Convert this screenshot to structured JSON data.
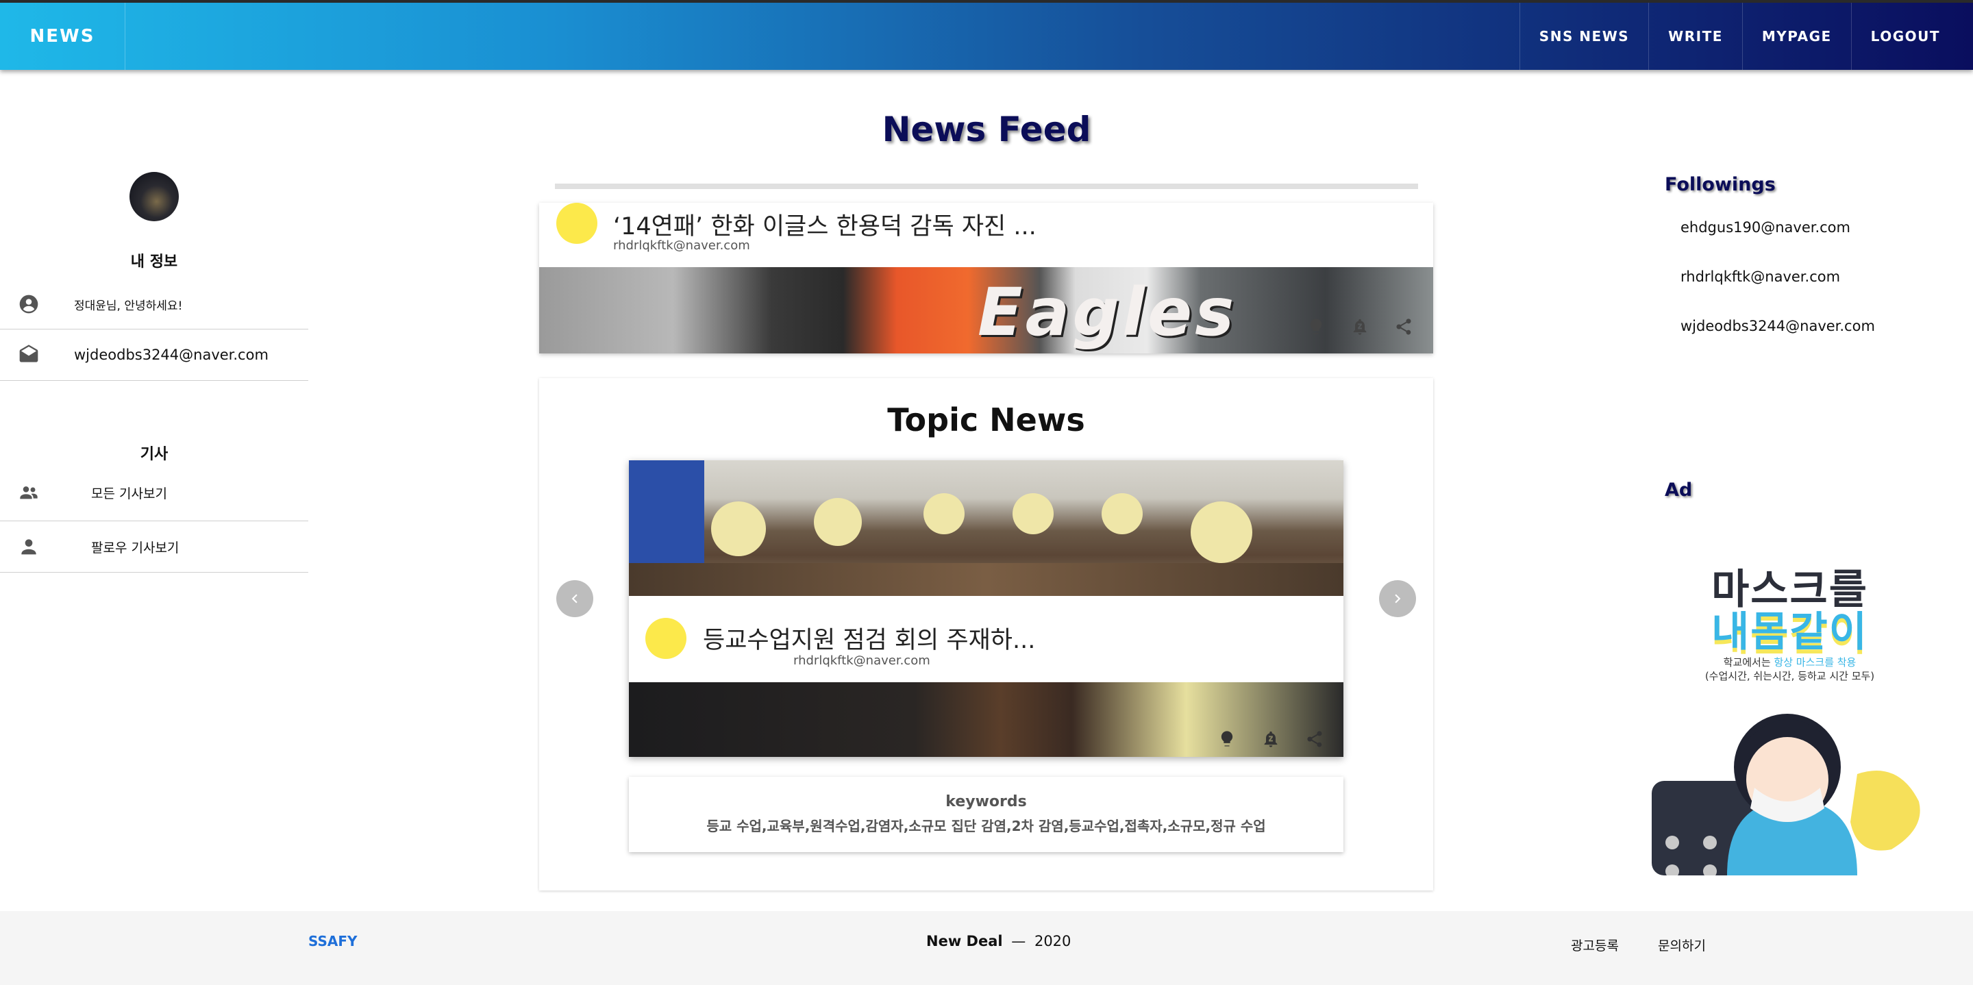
{
  "header": {
    "brand": "NEWS",
    "nav": [
      "SNS NEWS",
      "WRITE",
      "MYPAGE",
      "LOGOUT"
    ]
  },
  "page_title": "News Feed",
  "profile": {
    "section_title": "내 정보",
    "greeting": "정대윤님, 안녕하세요!",
    "email": "wjdeodbs3244@naver.com"
  },
  "articles_menu": {
    "section_title": "기사",
    "items": [
      "모든 기사보기",
      "팔로우 기사보기"
    ]
  },
  "feed": {
    "post": {
      "title": "‘14연패’ 한화 이글스 한용덕 감독 자진 ...",
      "author": "rhdrlqkftk@naver.com",
      "image_text": "Eagles"
    }
  },
  "topic": {
    "title": "Topic News",
    "slide": {
      "title": "등교수업지원 점검 회의 주재하...",
      "author": "rhdrlqkftk@naver.com"
    },
    "keywords_label": "keywords",
    "keywords": "등교 수업,교육부,원격수업,감염자,소규모 집단 감염,2차 감염,등교수업,접촉자,소규모,정규 수업"
  },
  "followings": {
    "title": "Followings",
    "items": [
      "ehdgus190@naver.com",
      "rhdrlqkftk@naver.com",
      "wjdeodbs3244@naver.com"
    ]
  },
  "ad": {
    "title": "Ad",
    "line1": "마스크를",
    "line2": "내몸같이",
    "sub1_pre": "학교에서는 ",
    "sub1_hl": "항상 마스크를 착용",
    "sub2": "(수업시간, 쉬는시간, 등하교 시간 모두)"
  },
  "footer": {
    "left": "SSAFY",
    "center_brand": "New Deal",
    "center_sep": "—",
    "center_year": "2020",
    "links": [
      "광고등록",
      "문의하기"
    ]
  },
  "colors": {
    "header_start": "#1fb8e8",
    "header_end": "#0a0e5e",
    "title_navy": "#0b0d58",
    "accent_yellow": "#fce94b",
    "footer_link": "#1e6fd9"
  }
}
